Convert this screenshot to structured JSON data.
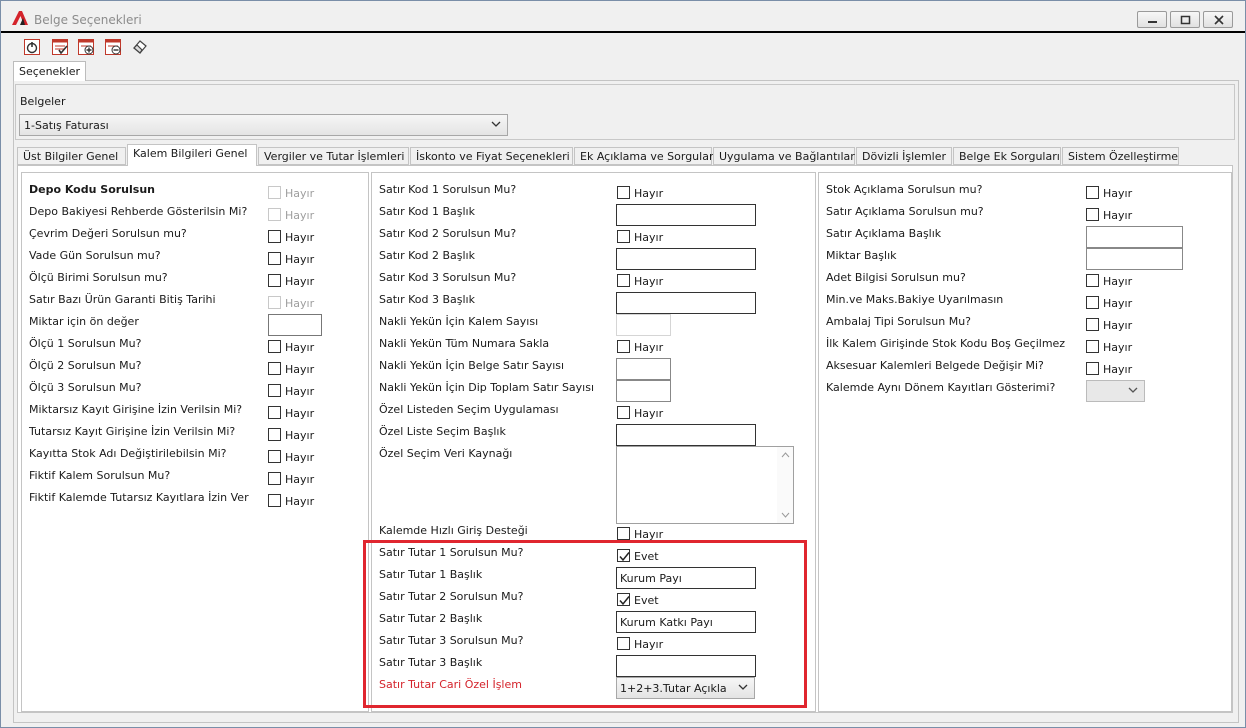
{
  "window": {
    "title": "Belge Seçenekleri"
  },
  "toolbar": {
    "icons": [
      "power-icon",
      "check-list-icon",
      "add-list-icon",
      "remove-list-icon",
      "eraser-icon"
    ]
  },
  "outer_tab": "Seçenekler",
  "belgeler": {
    "label": "Belgeler",
    "selected": "1-Satış Faturası"
  },
  "tabs": [
    "Üst Bilgiler Genel",
    "Kalem Bilgileri Genel",
    "Vergiler ve Tutar İşlemleri",
    "İskonto ve Fiyat Seçenekleri",
    "Ek Açıklama ve Sorgular",
    "Uygulama ve Bağlantılar",
    "Dövizli İşlemler",
    "Belge Ek Sorguları",
    "Sistem Özelleştirme"
  ],
  "no": "Hayır",
  "yes": "Evet",
  "col1": {
    "l0": "Depo Kodu Sorulsun",
    "l1": "Depo Bakiyesi Rehberde Gösterilsin Mi?",
    "l2": "Çevrim Değeri Sorulsun mu?",
    "l3": "Vade Gün Sorulsun mu?",
    "l4": "Ölçü Birimi Sorulsun mu?",
    "l5": "Satır Bazı Ürün Garanti Bitiş Tarihi",
    "l6": "Miktar için ön değer",
    "l7": "Ölçü 1 Sorulsun Mu?",
    "l8": "Ölçü 2 Sorulsun Mu?",
    "l9": "Ölçü 3 Sorulsun Mu?",
    "l10": "Miktarsız Kayıt Girişine İzin Verilsin Mi?",
    "l11": "Tutarsız Kayıt Girişine İzin Verilsin Mi?",
    "l12": "Kayıtta Stok Adı Değiştirilebilsin Mi?",
    "l13": "Fiktif Kalem Sorulsun Mu?",
    "l14": "Fiktif Kalemde Tutarsız Kayıtlara İzin Ver"
  },
  "col2": {
    "l0": "Satır Kod 1 Sorulsun Mu?",
    "l1": "Satır Kod 1 Başlık",
    "l2": "Satır Kod 2 Sorulsun Mu?",
    "l3": "Satır Kod 2 Başlık",
    "l4": "Satır Kod 3 Sorulsun Mu?",
    "l5": "Satır Kod 3 Başlık",
    "l6": "Nakli Yekün İçin Kalem Sayısı",
    "l7": "Nakli Yekün Tüm Numara Sakla",
    "l8": "Nakli Yekün İçin Belge Satır Sayısı",
    "l9": "Nakli Yekün İçin Dip Toplam Satır Sayısı",
    "l10": "Özel Listeden Seçim Uygulaması",
    "l11": "Özel Liste Seçim Başlık",
    "l12": "Özel Seçim Veri Kaynağı",
    "l13": "Kalemde Hızlı Giriş Desteği",
    "l14": "Satır Tutar 1 Sorulsun Mu?",
    "l15": "Satır Tutar 1 Başlık",
    "l16": "Satır Tutar 2 Sorulsun Mu?",
    "l17": "Satır Tutar 2 Başlık",
    "l18": "Satır Tutar 3 Sorulsun Mu?",
    "l19": "Satır Tutar 3 Başlık",
    "l20": "Satır Tutar Cari Özel İşlem",
    "v15": "Kurum Payı",
    "v17": "Kurum Katkı Payı",
    "v20": "1+2+3.Tutar Açıkla"
  },
  "col3": {
    "l0": "Stok Açıklama Sorulsun mu?",
    "l1": "Satır Açıklama Sorulsun mu?",
    "l2": "Satır Açıklama Başlık",
    "l3": "Miktar Başlık",
    "l4": "Adet Bilgisi Sorulsun mu?",
    "l5": "Min.ve Maks.Bakiye Uyarılmasın",
    "l6": "Ambalaj Tipi Sorulsun Mu?",
    "l7": "İlk Kalem Girişinde Stok Kodu Boş Geçilmez",
    "l8": "Aksesuar Kalemleri Belgede Değişir Mi?",
    "l9": "Kalemde Aynı Dönem Kayıtları Gösterimi?"
  }
}
